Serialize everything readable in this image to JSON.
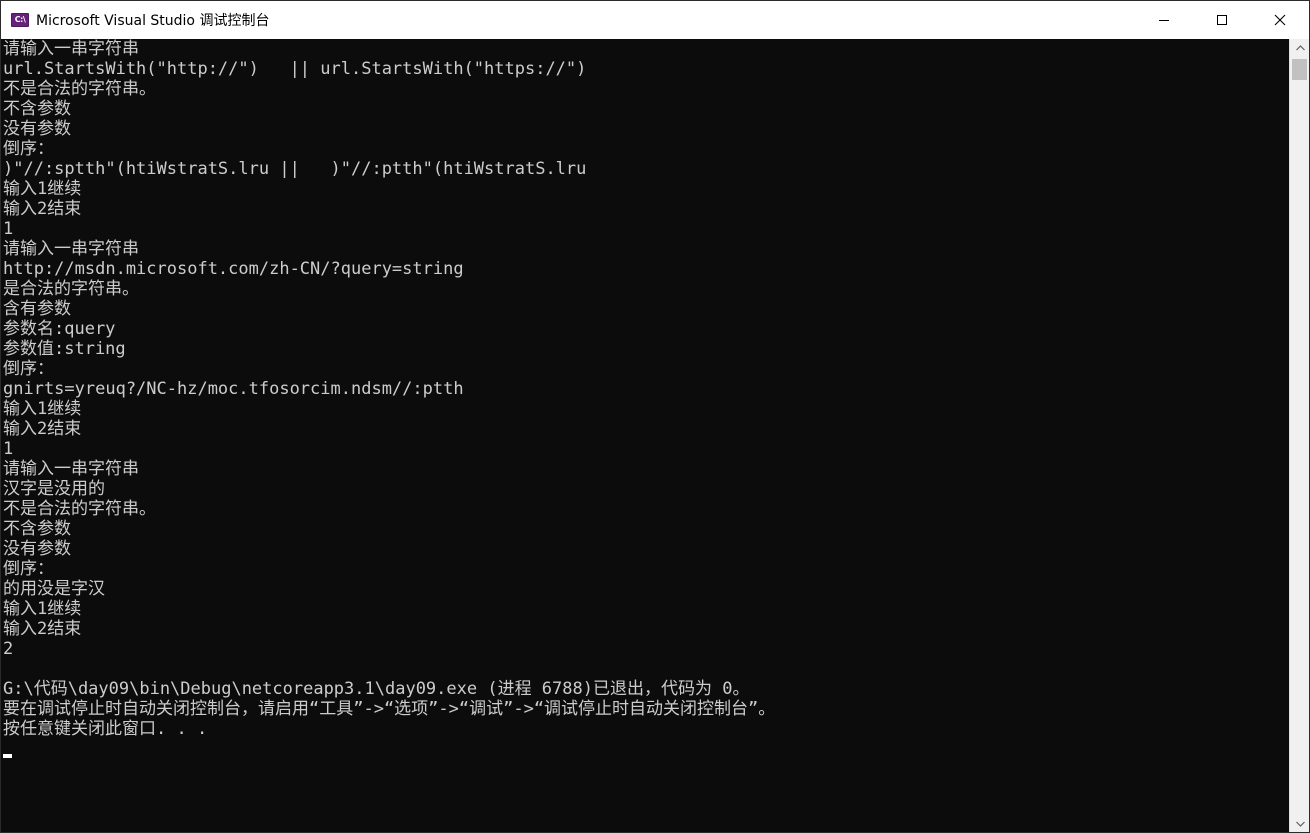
{
  "window": {
    "title": "Microsoft Visual Studio 调试控制台",
    "icon_label": "C:\\",
    "icon": "vs-debug-console-icon",
    "controls": {
      "minimize_icon": "minimize-icon",
      "maximize_icon": "maximize-icon",
      "close_icon": "close-icon"
    }
  },
  "console": {
    "background": "#0c0c0c",
    "foreground": "#cccccc",
    "lines": [
      "请输入一串字符串",
      "url.StartsWith(\"http://\")   || url.StartsWith(\"https://\")",
      "不是合法的字符串。",
      "不含参数",
      "没有参数",
      "倒序：",
      ")\"//:sptth\"(htiWstratS.lru ||   )\"//:ptth\"(htiWstratS.lru",
      "输入1继续",
      "输入2结束",
      "1",
      "请输入一串字符串",
      "http://msdn.microsoft.com/zh-CN/?query=string",
      "是合法的字符串。",
      "含有参数",
      "参数名:query",
      "参数值:string",
      "倒序：",
      "gnirts=yreuq?/NC-hz/moc.tfosorcim.ndsm//:ptth",
      "输入1继续",
      "输入2结束",
      "1",
      "请输入一串字符串",
      "汉字是没用的",
      "不是合法的字符串。",
      "不含参数",
      "没有参数",
      "倒序：",
      "的用没是字汉",
      "输入1继续",
      "输入2结束",
      "2",
      "",
      "G:\\代码\\day09\\bin\\Debug\\netcoreapp3.1\\day09.exe (进程 6788)已退出，代码为 0。",
      "要在调试停止时自动关闭控制台，请启用“工具”->“选项”->“调试”->“调试停止时自动关闭控制台”。",
      "按任意键关闭此窗口. . ."
    ]
  },
  "scrollbar": {
    "up_icon": "scroll-up-arrow-icon",
    "down_icon": "scroll-down-arrow-icon"
  }
}
